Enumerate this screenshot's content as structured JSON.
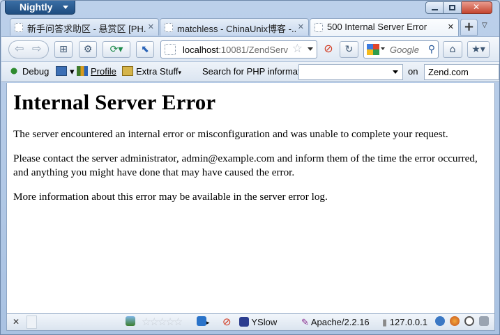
{
  "app_menu_label": "Nightly",
  "tabs": [
    {
      "label": "新手问答求助区 - 悬赏区 [PH...",
      "active": false
    },
    {
      "label": "matchless - ChinaUnix博客 -...",
      "active": false
    },
    {
      "label": "500 Internal Server Error",
      "active": true
    }
  ],
  "new_tab_symbol": "+",
  "url": {
    "host": "localhost",
    "rest": ":10081/ZendServ"
  },
  "search_placeholder": "Google",
  "bookmarks": {
    "debug": "Debug",
    "profile": "Profile",
    "extra_stuff": "Extra Stuff",
    "search_php_label": "Search for PHP information:",
    "php_query": "",
    "on_label": "on",
    "site": "Zend.com"
  },
  "page": {
    "heading": "Internal Server Error",
    "paragraphs": [
      "The server encountered an internal error or misconfiguration and was unable to complete your request.",
      "Please contact the server administrator, admin@example.com and inform them of the time the error occurred, and anything you might have done that may have caused the error.",
      "More information about this error may be available in the server error log."
    ]
  },
  "status": {
    "yslow": "YSlow",
    "server": "Apache/2.2.16",
    "ip": "127.0.0.1",
    "rating_stars": 0,
    "rating_max": 5
  },
  "colors": {
    "frame": "#bcd0ea",
    "app_button": "#2b5e96",
    "close_button": "#c4452f",
    "page_bg": "#ffffff"
  },
  "icons": {
    "back": "arrow-left-icon",
    "forward": "arrow-right-icon",
    "home": "home-icon",
    "reload": "reload-icon",
    "stop": "stop-icon",
    "bookmark_star": "star-icon",
    "search": "magnifier-icon"
  }
}
